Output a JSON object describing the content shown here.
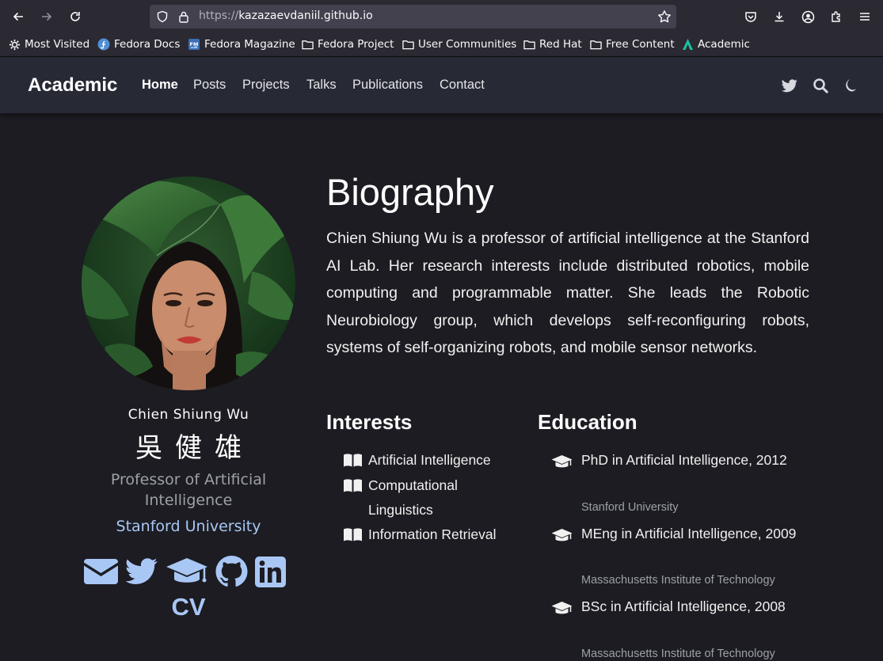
{
  "browser": {
    "url_scheme": "https://",
    "url_host": "kazazaevdaniil.github.io",
    "bookmarks": [
      {
        "label": "Most Visited",
        "icon": "gear-icon"
      },
      {
        "label": "Fedora Docs",
        "icon": "fedora-icon"
      },
      {
        "label": "Fedora Magazine",
        "icon": "fedora-magazine-icon"
      },
      {
        "label": "Fedora Project",
        "icon": "folder-icon"
      },
      {
        "label": "User Communities",
        "icon": "folder-icon"
      },
      {
        "label": "Red Hat",
        "icon": "folder-icon"
      },
      {
        "label": "Free Content",
        "icon": "folder-icon"
      },
      {
        "label": "Academic",
        "icon": "academic-logo-icon"
      }
    ]
  },
  "site": {
    "brand": "Academic",
    "nav": [
      "Home",
      "Posts",
      "Projects",
      "Talks",
      "Publications",
      "Contact"
    ],
    "active_nav": "Home",
    "nav_icons": [
      "twitter-icon",
      "search-icon",
      "moon-icon"
    ]
  },
  "profile": {
    "name": "Chien Shiung Wu",
    "name_cjk": "吳健雄",
    "role": "Professor of Artificial Intelligence",
    "organization": "Stanford University",
    "social_icons": [
      "envelope-icon",
      "twitter-icon",
      "graduation-cap-icon",
      "github-icon",
      "linkedin-icon"
    ],
    "cv_label": "CV"
  },
  "biography": {
    "title": "Biography",
    "text": "Chien Shiung Wu is a professor of artificial intelligence at the Stanford AI Lab. Her research interests include distributed robotics, mobile computing and programmable matter. She leads the Robotic Neurobiology group, which develops self-reconfiguring robots, systems of self-organizing robots, and mobile sensor networks."
  },
  "interests": {
    "title": "Interests",
    "items": [
      "Artificial Intelligence",
      "Computational Linguistics",
      "Information Retrieval"
    ]
  },
  "education": {
    "title": "Education",
    "items": [
      {
        "degree": "PhD in Artificial Intelligence, 2012",
        "institution": "Stanford University"
      },
      {
        "degree": "MEng in Artificial Intelligence, 2009",
        "institution": "Massachusetts Institute of Technology"
      },
      {
        "degree": "BSc in Artificial Intelligence, 2008",
        "institution": "Massachusetts Institute of Technology"
      }
    ]
  },
  "colors": {
    "page_bg": "#1c1c22",
    "navbar_bg": "#272a35",
    "link_blue": "#a9c7f4",
    "muted_text": "#9da0a8"
  }
}
